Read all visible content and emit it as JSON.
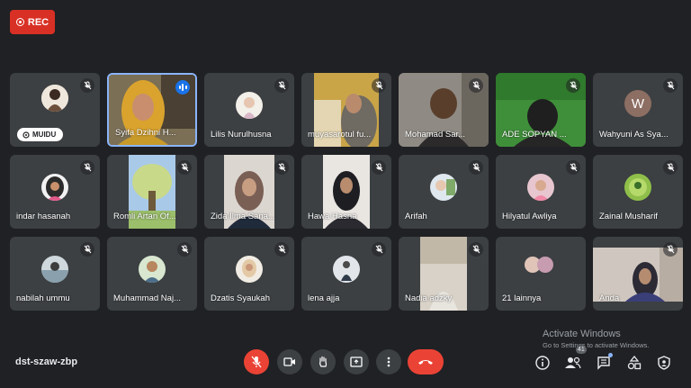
{
  "recording": {
    "label": "REC"
  },
  "meeting": {
    "code": "dst-szaw-zbp"
  },
  "participants": [
    {
      "name": "MUIDU",
      "presenter_badge": true
    },
    {
      "name": "Syifa Dzihni H..."
    },
    {
      "name": "Lilis Nurulhusna"
    },
    {
      "name": "muyasarotul fu..."
    },
    {
      "name": "Mohamad Sar..."
    },
    {
      "name": "ADE SOPYAN ..."
    },
    {
      "name": "Wahyuni As Sya...",
      "initial": "W"
    },
    {
      "name": "indar hasanah"
    },
    {
      "name": "Romli Artan Of..."
    },
    {
      "name": "Zida Ilma Sana..."
    },
    {
      "name": "Hawa Hasna"
    },
    {
      "name": "Arifah"
    },
    {
      "name": "Hilyatul Awliya"
    },
    {
      "name": "Zainal Musharif"
    },
    {
      "name": "nabilah ummu"
    },
    {
      "name": "Muhammad Naj..."
    },
    {
      "name": "Dzatis Syaukah"
    },
    {
      "name": "lena ajja"
    },
    {
      "name": "Nadia adzky"
    },
    {
      "name": "21 lainnya"
    },
    {
      "name": "Anda"
    }
  ],
  "people_count": "41",
  "watermark": {
    "title": "Activate Windows",
    "subtitle": "Go to Settings to activate Windows."
  },
  "colors": {
    "background": "#202124",
    "tile": "#3c4043",
    "danger": "#ea4335",
    "speaking": "#8ab4f8"
  }
}
